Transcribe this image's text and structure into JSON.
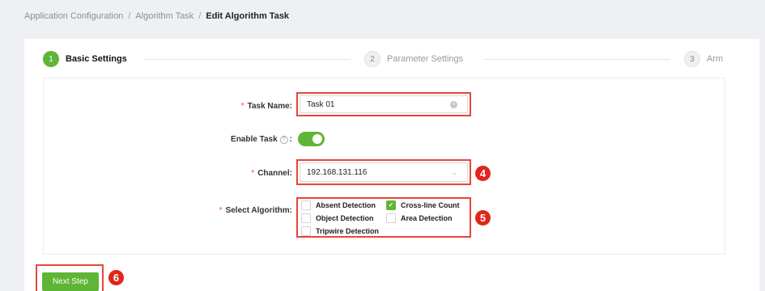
{
  "breadcrumb": {
    "items": [
      "Application Configuration",
      "Algorithm Task",
      "Edit Algorithm Task"
    ],
    "separator": "/"
  },
  "steps": [
    {
      "number": "1",
      "label": "Basic Settings",
      "active": true
    },
    {
      "number": "2",
      "label": "Parameter Settings",
      "active": false
    },
    {
      "number": "3",
      "label": "Arm",
      "active": false
    }
  ],
  "form": {
    "task_name": {
      "label": "Task Name",
      "value": "Task 01",
      "required": true
    },
    "enable_task": {
      "label": "Enable Task",
      "enabled": true,
      "help_glyph": "?"
    },
    "channel": {
      "label": "Channel",
      "value": "192.168.131.116",
      "required": true
    },
    "algorithm": {
      "label": "Select Algorithm",
      "required": true,
      "options": [
        {
          "label": "Absent Detection",
          "checked": false
        },
        {
          "label": "Cross-line Count",
          "checked": true
        },
        {
          "label": "Object Detection",
          "checked": false
        },
        {
          "label": "Area Detection",
          "checked": false
        },
        {
          "label": "Tripwire Detection",
          "checked": false
        }
      ]
    }
  },
  "next_button": {
    "label": "Next Step"
  },
  "callouts": {
    "channel": "4",
    "algorithm": "5",
    "next": "6"
  },
  "colors": {
    "accent": "#5fb535",
    "highlight": "#e8453c",
    "badge": "#e0251b",
    "required": "#e94b3c"
  }
}
